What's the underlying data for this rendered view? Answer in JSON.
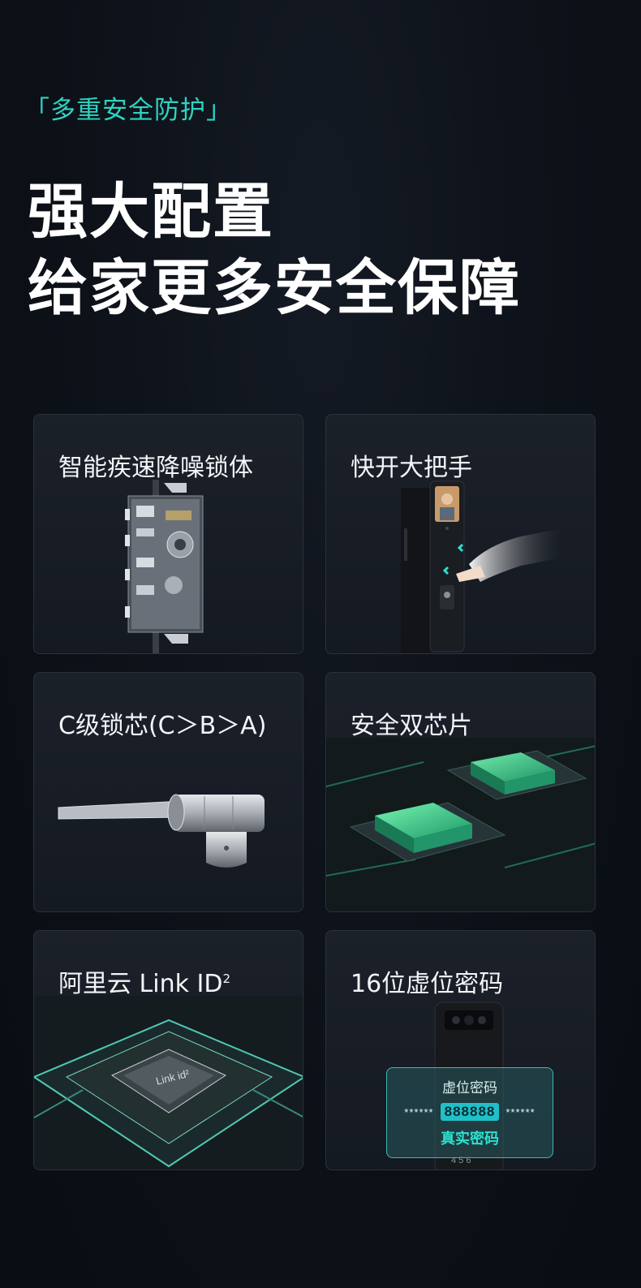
{
  "header": {
    "tagline": "「多重安全防护」",
    "headline_line1": "强大配置",
    "headline_line2": "给家更多安全保障"
  },
  "cards": [
    {
      "title": "智能疾速降噪锁体"
    },
    {
      "title": "快开大把手"
    },
    {
      "title": "C级锁芯(C＞B＞A)"
    },
    {
      "title": "安全双芯片"
    },
    {
      "title": "阿里云 Link ID",
      "superscript": "2"
    },
    {
      "title": "16位虚位密码"
    }
  ],
  "chip_label": "Link id²",
  "password_demo": {
    "virtual_label": "虚位密码",
    "masked_left": "******",
    "real_code": "888888",
    "masked_right": "******",
    "real_label": "真实密码",
    "keypad_digits": "4 5 6"
  },
  "colors": {
    "accent": "#2fd3c0",
    "background": "#0c1017",
    "card": "#181d26"
  }
}
